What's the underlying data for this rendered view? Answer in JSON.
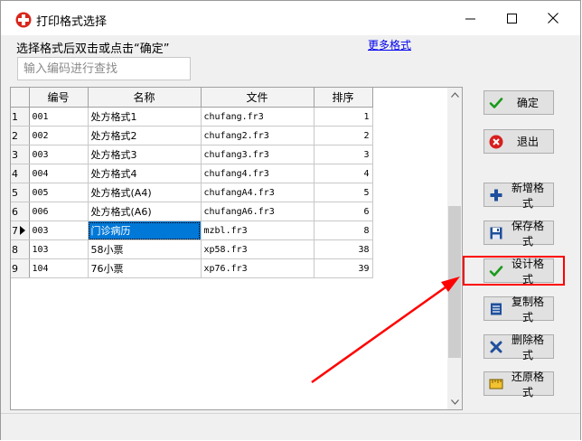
{
  "window": {
    "title": "打印格式选择",
    "minimize_glyph": "—",
    "maximize_glyph": "☐",
    "close_glyph": "✕"
  },
  "header": {
    "hint": "选择格式后双击或点击“确定”",
    "more_link": "更多格式"
  },
  "search": {
    "placeholder": "输入编码进行查找",
    "value": ""
  },
  "table": {
    "columns": [
      "编号",
      "名称",
      "文件",
      "排序"
    ],
    "rows": [
      {
        "index": "1",
        "code": "001",
        "name": "处方格式1",
        "file": "chufang.fr3",
        "order": "1"
      },
      {
        "index": "2",
        "code": "002",
        "name": "处方格式2",
        "file": "chufang2.fr3",
        "order": "2"
      },
      {
        "index": "3",
        "code": "003",
        "name": "处方格式3",
        "file": "chufang3.fr3",
        "order": "3"
      },
      {
        "index": "4",
        "code": "004",
        "name": "处方格式4",
        "file": "chufang4.fr3",
        "order": "4"
      },
      {
        "index": "5",
        "code": "005",
        "name": "处方格式(A4)",
        "file": "chufangA4.fr3",
        "order": "5"
      },
      {
        "index": "6",
        "code": "006",
        "name": "处方格式(A6)",
        "file": "chufangA6.fr3",
        "order": "6"
      },
      {
        "index": "7",
        "code": "003",
        "name": "门诊病历",
        "file": "mzbl.fr3",
        "order": "8",
        "current": true
      },
      {
        "index": "8",
        "code": "103",
        "name": "58小票",
        "file": "xp58.fr3",
        "order": "38"
      },
      {
        "index": "9",
        "code": "104",
        "name": "76小票",
        "file": "xp76.fr3",
        "order": "39"
      }
    ]
  },
  "buttons": {
    "ok": "确定",
    "exit": "退出",
    "add": "新增格式",
    "save": "保存格式",
    "design": "设计格式",
    "copy": "复制格式",
    "delete": "删除格式",
    "restore": "还原格式"
  },
  "colors": {
    "selection": "#0078d7",
    "annotation": "#ff0000",
    "ok_icon": "#1a9a1a",
    "exit_icon": "#d81e1e",
    "blue_icon": "#1f4f9c"
  },
  "icons": {
    "app": "red-cross-icon",
    "ok": "check-icon",
    "exit": "close-circle-icon",
    "add": "plus-icon",
    "save": "floppy-icon",
    "design": "check-icon",
    "copy": "document-icon",
    "delete": "x-icon",
    "restore": "ruler-icon"
  }
}
